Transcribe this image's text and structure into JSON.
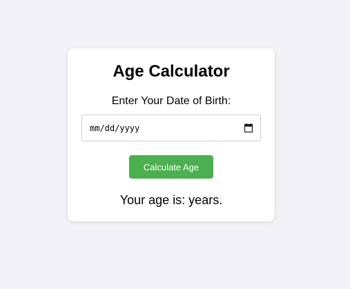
{
  "card": {
    "title": "Age Calculator",
    "dob_label": "Enter Your Date of Birth:",
    "date_input": {
      "placeholder": "mm/dd/yyyy",
      "value": ""
    },
    "calculate_button_label": "Calculate Age",
    "result_text": "Your age is: years."
  },
  "colors": {
    "page_background": "#f2f2f7",
    "card_background": "#ffffff",
    "button_background": "#4caf50",
    "button_text": "#ffffff"
  },
  "icons": {
    "date_picker": "calendar-icon"
  }
}
